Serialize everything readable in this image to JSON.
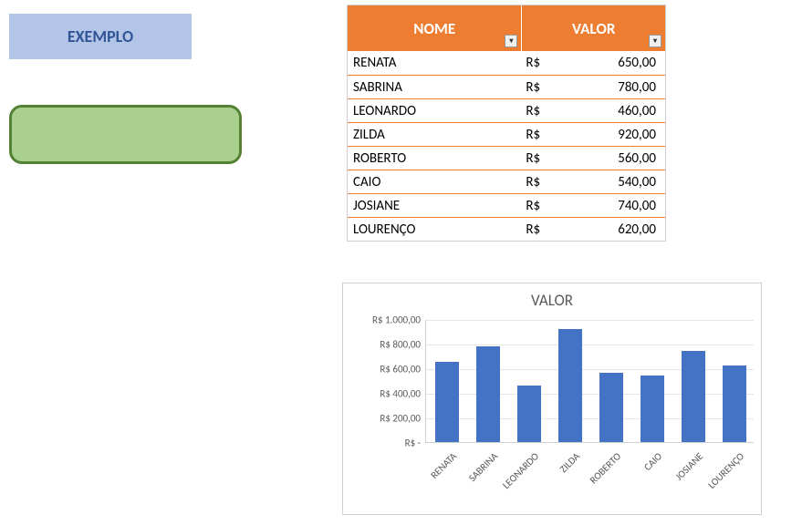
{
  "exemplo_label": "EXEMPLO",
  "table": {
    "headers": {
      "nome": "NOME",
      "valor": "VALOR"
    },
    "currency": "R$",
    "rows": [
      {
        "nome": "RENATA",
        "valor": "650,00"
      },
      {
        "nome": "SABRINA",
        "valor": "780,00"
      },
      {
        "nome": "LEONARDO",
        "valor": "460,00"
      },
      {
        "nome": "ZILDA",
        "valor": "920,00"
      },
      {
        "nome": "ROBERTO",
        "valor": "560,00"
      },
      {
        "nome": "CAIO",
        "valor": "540,00"
      },
      {
        "nome": "JOSIANE",
        "valor": "740,00"
      },
      {
        "nome": "LOURENÇO",
        "valor": "620,00"
      }
    ]
  },
  "chart_data": {
    "type": "bar",
    "title": "VALOR",
    "xlabel": "",
    "ylabel": "",
    "categories": [
      "RENATA",
      "SABRINA",
      "LEONARDO",
      "ZILDA",
      "ROBERTO",
      "CAIO",
      "JOSIANE",
      "LOURENÇO"
    ],
    "values": [
      650,
      780,
      460,
      920,
      560,
      540,
      740,
      620
    ],
    "ylim": [
      0,
      1000
    ],
    "yticks": [
      0,
      200,
      400,
      600,
      800,
      1000
    ],
    "ytick_labels": [
      "R$ -",
      "R$ 200,00",
      "R$ 400,00",
      "R$ 600,00",
      "R$ 800,00",
      "R$ 1.000,00"
    ]
  }
}
